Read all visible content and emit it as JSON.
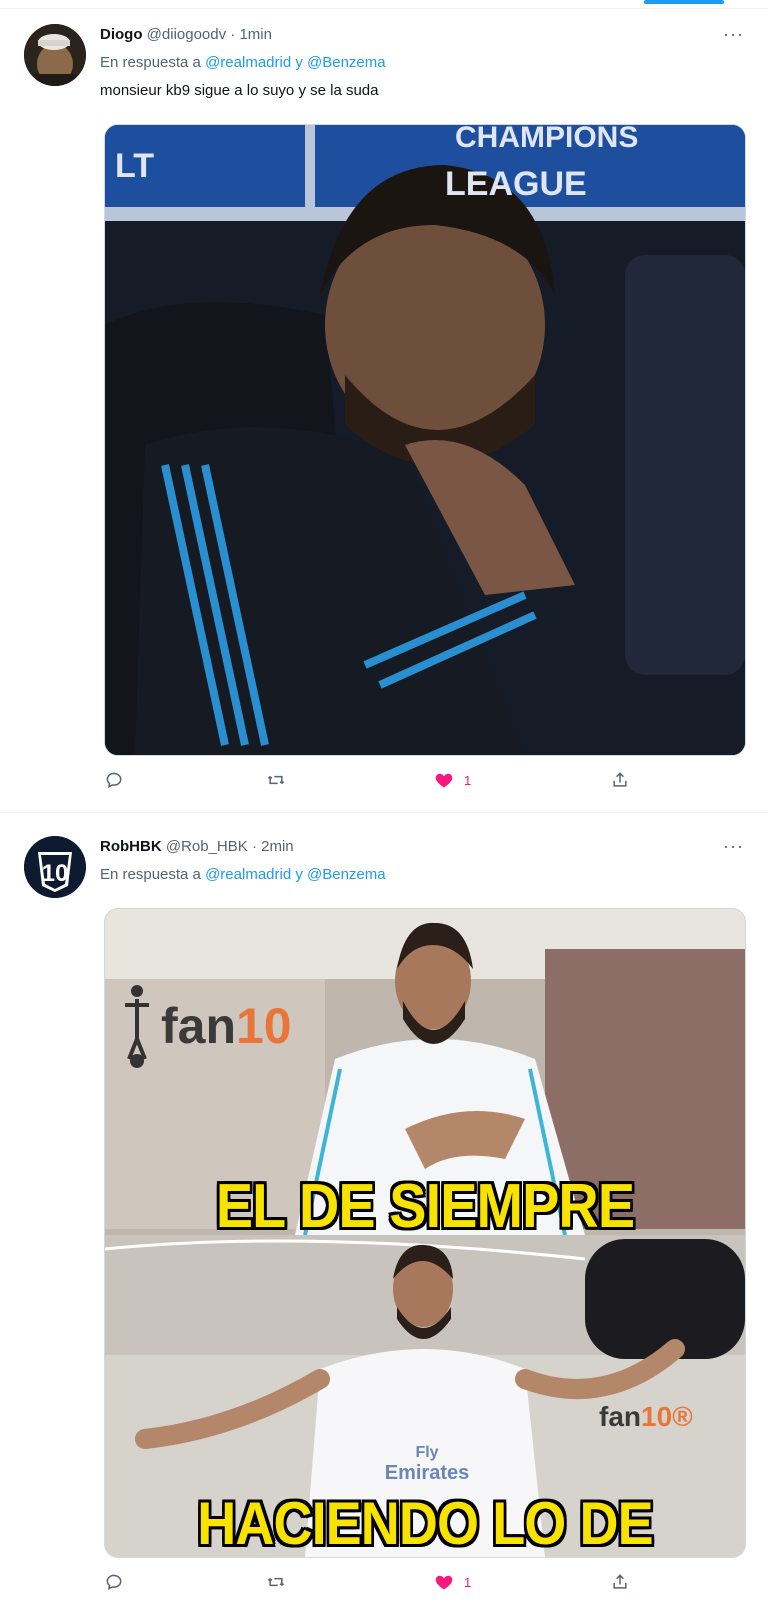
{
  "tweets": [
    {
      "name": "Diogo",
      "handle": "@diiogoodv",
      "time": "· 1min",
      "reply_prefix": "En respuesta a",
      "mentions": "@realmadrid y @Benzema",
      "text": "monsieur kb9 sigue a lo suyo y se la suda",
      "media": {
        "banner_line1": "CHAMPIONS",
        "banner_line2": "LEAGUE",
        "banner_left": "LT"
      },
      "more": "···",
      "actions": {
        "reply_count": "",
        "retweet_count": "",
        "like_count": "1",
        "liked": true
      }
    },
    {
      "name": "RobHBK",
      "handle": "@Rob_HBK",
      "time": "· 2min",
      "reply_prefix": "En respuesta a",
      "mentions": "@realmadrid y @Benzema",
      "text": "",
      "avatar_text": "10",
      "media": {
        "caption_top": "EL DE SIEMPRE",
        "caption_bottom": "HACIENDO LO DE SIEMPRE",
        "watermark_1_a": "fan",
        "watermark_1_b": "10",
        "watermark_2_a": "fan",
        "watermark_2_b": "10®",
        "shirt_text_1": "Fly",
        "shirt_text_2": "Emirates"
      },
      "more": "···",
      "actions": {
        "reply_count": "",
        "retweet_count": "",
        "like_count": "1",
        "liked": true
      }
    }
  ],
  "colors": {
    "accent": "#1d9bf0",
    "like": "#f91880",
    "meme_text": "#f7e200"
  },
  "icons": {
    "reply": "reply-icon",
    "retweet": "retweet-icon",
    "like": "heart-icon",
    "share": "share-icon",
    "more": "more-icon"
  }
}
